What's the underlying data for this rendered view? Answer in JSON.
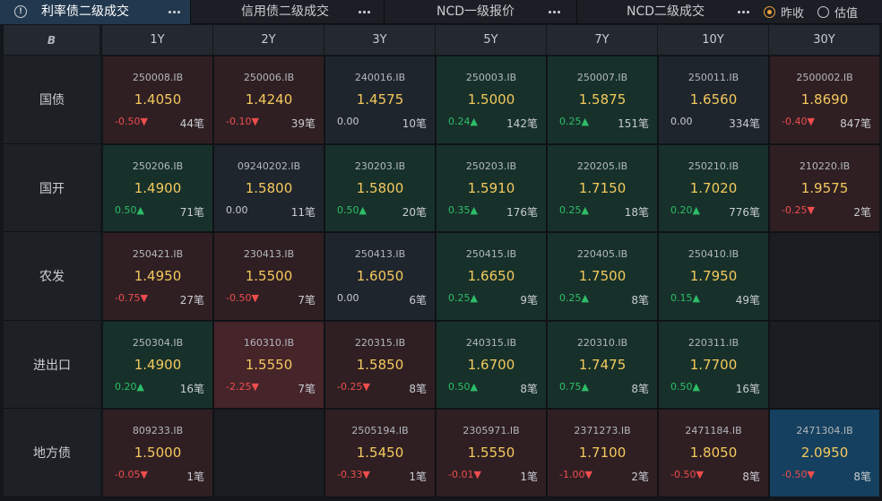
{
  "tabs": [
    {
      "label": "利率债二级成交",
      "active": true
    },
    {
      "label": "信用债二级成交",
      "active": false
    },
    {
      "label": "NCD一级报价",
      "active": false
    },
    {
      "label": "NCD二级成交",
      "active": false
    }
  ],
  "info_glyph": "!",
  "radios": [
    {
      "label": "昨收",
      "selected": true
    },
    {
      "label": "估值",
      "selected": false
    }
  ],
  "corner_logo": "B",
  "columns": [
    "1Y",
    "2Y",
    "3Y",
    "5Y",
    "7Y",
    "10Y",
    "30Y"
  ],
  "rows": [
    {
      "label": "国债",
      "cells": [
        {
          "tone": "red",
          "code": "250008.IB",
          "yield": "1.4050",
          "change": "-0.50",
          "dir": "down",
          "count": "44笔"
        },
        {
          "tone": "red",
          "code": "250006.IB",
          "yield": "1.4240",
          "change": "-0.10",
          "dir": "down",
          "count": "39笔"
        },
        {
          "tone": "neu",
          "code": "240016.IB",
          "yield": "1.4575",
          "change": "0.00",
          "dir": "flat",
          "count": "10笔"
        },
        {
          "tone": "green",
          "code": "250003.IB",
          "yield": "1.5000",
          "change": "0.24",
          "dir": "up",
          "count": "142笔"
        },
        {
          "tone": "green",
          "code": "250007.IB",
          "yield": "1.5875",
          "change": "0.25",
          "dir": "up",
          "count": "151笔"
        },
        {
          "tone": "neu",
          "code": "250011.IB",
          "yield": "1.6560",
          "change": "0.00",
          "dir": "flat",
          "count": "334笔"
        },
        {
          "tone": "red",
          "code": "2500002.IB",
          "yield": "1.8690",
          "change": "-0.40",
          "dir": "down",
          "count": "847笔"
        }
      ]
    },
    {
      "label": "国开",
      "cells": [
        {
          "tone": "green",
          "code": "250206.IB",
          "yield": "1.4900",
          "change": "0.50",
          "dir": "up",
          "count": "71笔"
        },
        {
          "tone": "neu",
          "code": "09240202.IB",
          "yield": "1.5800",
          "change": "0.00",
          "dir": "flat",
          "count": "11笔"
        },
        {
          "tone": "green",
          "code": "230203.IB",
          "yield": "1.5800",
          "change": "0.50",
          "dir": "up",
          "count": "20笔"
        },
        {
          "tone": "green",
          "code": "250203.IB",
          "yield": "1.5910",
          "change": "0.35",
          "dir": "up",
          "count": "176笔"
        },
        {
          "tone": "green",
          "code": "220205.IB",
          "yield": "1.7150",
          "change": "0.25",
          "dir": "up",
          "count": "18笔"
        },
        {
          "tone": "green",
          "code": "250210.IB",
          "yield": "1.7020",
          "change": "0.20",
          "dir": "up",
          "count": "776笔"
        },
        {
          "tone": "red",
          "code": "210220.IB",
          "yield": "1.9575",
          "change": "-0.25",
          "dir": "down",
          "count": "2笔"
        }
      ]
    },
    {
      "label": "农发",
      "cells": [
        {
          "tone": "red",
          "code": "250421.IB",
          "yield": "1.4950",
          "change": "-0.75",
          "dir": "down",
          "count": "27笔"
        },
        {
          "tone": "red",
          "code": "230413.IB",
          "yield": "1.5500",
          "change": "-0.50",
          "dir": "down",
          "count": "7笔"
        },
        {
          "tone": "neu",
          "code": "250413.IB",
          "yield": "1.6050",
          "change": "0.00",
          "dir": "flat",
          "count": "6笔"
        },
        {
          "tone": "green",
          "code": "250415.IB",
          "yield": "1.6650",
          "change": "0.25",
          "dir": "up",
          "count": "9笔"
        },
        {
          "tone": "green",
          "code": "220405.IB",
          "yield": "1.7500",
          "change": "0.25",
          "dir": "up",
          "count": "8笔"
        },
        {
          "tone": "green",
          "code": "250410.IB",
          "yield": "1.7950",
          "change": "0.15",
          "dir": "up",
          "count": "49笔"
        },
        {
          "tone": "empty"
        }
      ]
    },
    {
      "label": "进出口",
      "cells": [
        {
          "tone": "green",
          "code": "250304.IB",
          "yield": "1.4900",
          "change": "0.20",
          "dir": "up",
          "count": "16笔"
        },
        {
          "tone": "red hi",
          "code": "160310.IB",
          "yield": "1.5550",
          "change": "-2.25",
          "dir": "down",
          "count": "7笔"
        },
        {
          "tone": "red",
          "code": "220315.IB",
          "yield": "1.5850",
          "change": "-0.25",
          "dir": "down",
          "count": "8笔"
        },
        {
          "tone": "green",
          "code": "240315.IB",
          "yield": "1.6700",
          "change": "0.50",
          "dir": "up",
          "count": "8笔"
        },
        {
          "tone": "green",
          "code": "220310.IB",
          "yield": "1.7475",
          "change": "0.75",
          "dir": "up",
          "count": "8笔"
        },
        {
          "tone": "green",
          "code": "220311.IB",
          "yield": "1.7700",
          "change": "0.50",
          "dir": "up",
          "count": "16笔"
        },
        {
          "tone": "empty"
        }
      ]
    },
    {
      "label": "地方债",
      "cells": [
        {
          "tone": "red",
          "code": "809233.IB",
          "yield": "1.5000",
          "change": "-0.05",
          "dir": "down",
          "count": "1笔"
        },
        {
          "tone": "empty"
        },
        {
          "tone": "red",
          "code": "2505194.IB",
          "yield": "1.5450",
          "change": "-0.33",
          "dir": "down",
          "count": "1笔"
        },
        {
          "tone": "red",
          "code": "2305971.IB",
          "yield": "1.5550",
          "change": "-0.01",
          "dir": "down",
          "count": "1笔"
        },
        {
          "tone": "red",
          "code": "2371273.IB",
          "yield": "1.7100",
          "change": "-1.00",
          "dir": "down",
          "count": "2笔"
        },
        {
          "tone": "red",
          "code": "2471184.IB",
          "yield": "1.8050",
          "change": "-0.50",
          "dir": "down",
          "count": "8笔"
        },
        {
          "tone": "blue",
          "code": "2471304.IB",
          "yield": "2.0950",
          "change": "-0.50",
          "dir": "down",
          "count": "8笔"
        }
      ]
    }
  ],
  "colors": {
    "up": "#2ebd68",
    "down": "#ee4d4d",
    "yield": "#f4c95d",
    "accent": "#f0a23c"
  }
}
